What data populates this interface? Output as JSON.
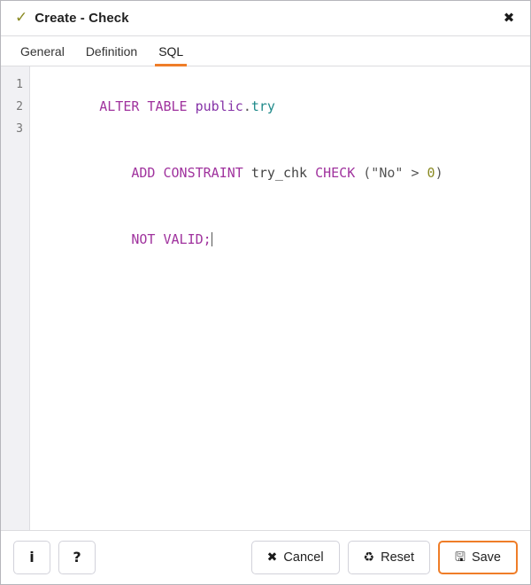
{
  "window": {
    "status_icon": "check-icon",
    "title": "Create - Check",
    "close_icon": "✖"
  },
  "tabs": [
    {
      "label": "General",
      "active": false
    },
    {
      "label": "Definition",
      "active": false
    },
    {
      "label": "SQL",
      "active": true
    }
  ],
  "editor": {
    "line_numbers": [
      "1",
      "2",
      "3"
    ],
    "lines": [
      {
        "tokens": [
          {
            "text": "ALTER TABLE ",
            "type": "kw"
          },
          {
            "text": "public",
            "type": "schema"
          },
          {
            "text": ".",
            "type": "punct"
          },
          {
            "text": "try",
            "type": "ident"
          }
        ]
      },
      {
        "tokens": [
          {
            "text": "    ",
            "type": "plain"
          },
          {
            "text": "ADD CONSTRAINT ",
            "type": "kw"
          },
          {
            "text": "try_chk ",
            "type": "name"
          },
          {
            "text": "CHECK ",
            "type": "kw"
          },
          {
            "text": "(\"No\" > ",
            "type": "punct"
          },
          {
            "text": "0",
            "type": "num"
          },
          {
            "text": ")",
            "type": "punct"
          }
        ]
      },
      {
        "tokens": [
          {
            "text": "    ",
            "type": "plain"
          },
          {
            "text": "NOT VALID;",
            "type": "kw"
          }
        ],
        "caret": true
      }
    ],
    "plain_text": "ALTER TABLE public.try\n    ADD CONSTRAINT try_chk CHECK (\"No\" > 0)\n    NOT VALID;"
  },
  "footer": {
    "info_label": "i",
    "help_label": "?",
    "cancel_icon": "✖",
    "cancel_label": "Cancel",
    "reset_icon": "♻",
    "reset_label": "Reset",
    "save_icon": "🖫",
    "save_label": "Save"
  },
  "colors": {
    "accent_orange": "#ef7d28",
    "keyword": "#a0339e",
    "schema": "#8634a8",
    "identifier": "#1f8a8a",
    "number": "#8a8a22",
    "check_icon": "#8a8a22"
  }
}
